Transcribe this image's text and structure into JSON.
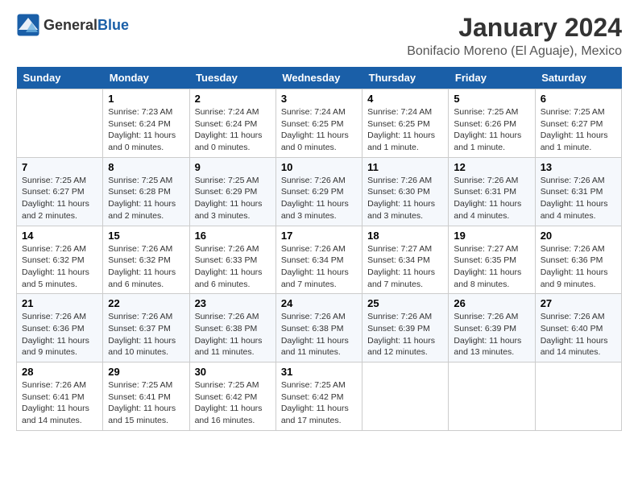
{
  "header": {
    "logo_general": "General",
    "logo_blue": "Blue",
    "main_title": "January 2024",
    "subtitle": "Bonifacio Moreno (El Aguaje), Mexico"
  },
  "calendar": {
    "days_of_week": [
      "Sunday",
      "Monday",
      "Tuesday",
      "Wednesday",
      "Thursday",
      "Friday",
      "Saturday"
    ],
    "weeks": [
      [
        {
          "day": "",
          "info": ""
        },
        {
          "day": "1",
          "info": "Sunrise: 7:23 AM\nSunset: 6:24 PM\nDaylight: 11 hours\nand 0 minutes."
        },
        {
          "day": "2",
          "info": "Sunrise: 7:24 AM\nSunset: 6:24 PM\nDaylight: 11 hours\nand 0 minutes."
        },
        {
          "day": "3",
          "info": "Sunrise: 7:24 AM\nSunset: 6:25 PM\nDaylight: 11 hours\nand 0 minutes."
        },
        {
          "day": "4",
          "info": "Sunrise: 7:24 AM\nSunset: 6:25 PM\nDaylight: 11 hours\nand 1 minute."
        },
        {
          "day": "5",
          "info": "Sunrise: 7:25 AM\nSunset: 6:26 PM\nDaylight: 11 hours\nand 1 minute."
        },
        {
          "day": "6",
          "info": "Sunrise: 7:25 AM\nSunset: 6:27 PM\nDaylight: 11 hours\nand 1 minute."
        }
      ],
      [
        {
          "day": "7",
          "info": "Sunrise: 7:25 AM\nSunset: 6:27 PM\nDaylight: 11 hours\nand 2 minutes."
        },
        {
          "day": "8",
          "info": "Sunrise: 7:25 AM\nSunset: 6:28 PM\nDaylight: 11 hours\nand 2 minutes."
        },
        {
          "day": "9",
          "info": "Sunrise: 7:25 AM\nSunset: 6:29 PM\nDaylight: 11 hours\nand 3 minutes."
        },
        {
          "day": "10",
          "info": "Sunrise: 7:26 AM\nSunset: 6:29 PM\nDaylight: 11 hours\nand 3 minutes."
        },
        {
          "day": "11",
          "info": "Sunrise: 7:26 AM\nSunset: 6:30 PM\nDaylight: 11 hours\nand 3 minutes."
        },
        {
          "day": "12",
          "info": "Sunrise: 7:26 AM\nSunset: 6:31 PM\nDaylight: 11 hours\nand 4 minutes."
        },
        {
          "day": "13",
          "info": "Sunrise: 7:26 AM\nSunset: 6:31 PM\nDaylight: 11 hours\nand 4 minutes."
        }
      ],
      [
        {
          "day": "14",
          "info": "Sunrise: 7:26 AM\nSunset: 6:32 PM\nDaylight: 11 hours\nand 5 minutes."
        },
        {
          "day": "15",
          "info": "Sunrise: 7:26 AM\nSunset: 6:32 PM\nDaylight: 11 hours\nand 6 minutes."
        },
        {
          "day": "16",
          "info": "Sunrise: 7:26 AM\nSunset: 6:33 PM\nDaylight: 11 hours\nand 6 minutes."
        },
        {
          "day": "17",
          "info": "Sunrise: 7:26 AM\nSunset: 6:34 PM\nDaylight: 11 hours\nand 7 minutes."
        },
        {
          "day": "18",
          "info": "Sunrise: 7:27 AM\nSunset: 6:34 PM\nDaylight: 11 hours\nand 7 minutes."
        },
        {
          "day": "19",
          "info": "Sunrise: 7:27 AM\nSunset: 6:35 PM\nDaylight: 11 hours\nand 8 minutes."
        },
        {
          "day": "20",
          "info": "Sunrise: 7:26 AM\nSunset: 6:36 PM\nDaylight: 11 hours\nand 9 minutes."
        }
      ],
      [
        {
          "day": "21",
          "info": "Sunrise: 7:26 AM\nSunset: 6:36 PM\nDaylight: 11 hours\nand 9 minutes."
        },
        {
          "day": "22",
          "info": "Sunrise: 7:26 AM\nSunset: 6:37 PM\nDaylight: 11 hours\nand 10 minutes."
        },
        {
          "day": "23",
          "info": "Sunrise: 7:26 AM\nSunset: 6:38 PM\nDaylight: 11 hours\nand 11 minutes."
        },
        {
          "day": "24",
          "info": "Sunrise: 7:26 AM\nSunset: 6:38 PM\nDaylight: 11 hours\nand 11 minutes."
        },
        {
          "day": "25",
          "info": "Sunrise: 7:26 AM\nSunset: 6:39 PM\nDaylight: 11 hours\nand 12 minutes."
        },
        {
          "day": "26",
          "info": "Sunrise: 7:26 AM\nSunset: 6:39 PM\nDaylight: 11 hours\nand 13 minutes."
        },
        {
          "day": "27",
          "info": "Sunrise: 7:26 AM\nSunset: 6:40 PM\nDaylight: 11 hours\nand 14 minutes."
        }
      ],
      [
        {
          "day": "28",
          "info": "Sunrise: 7:26 AM\nSunset: 6:41 PM\nDaylight: 11 hours\nand 14 minutes."
        },
        {
          "day": "29",
          "info": "Sunrise: 7:25 AM\nSunset: 6:41 PM\nDaylight: 11 hours\nand 15 minutes."
        },
        {
          "day": "30",
          "info": "Sunrise: 7:25 AM\nSunset: 6:42 PM\nDaylight: 11 hours\nand 16 minutes."
        },
        {
          "day": "31",
          "info": "Sunrise: 7:25 AM\nSunset: 6:42 PM\nDaylight: 11 hours\nand 17 minutes."
        },
        {
          "day": "",
          "info": ""
        },
        {
          "day": "",
          "info": ""
        },
        {
          "day": "",
          "info": ""
        }
      ]
    ]
  }
}
